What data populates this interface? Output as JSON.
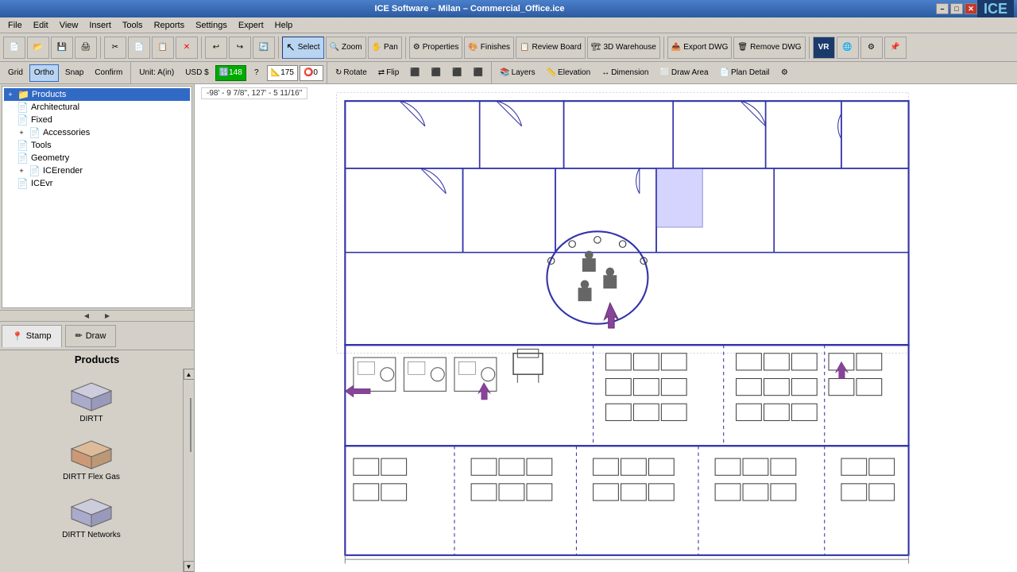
{
  "app": {
    "title": "ICE Software – Milan – Commercial_Office.ice",
    "logo": "ICE",
    "win_controls": [
      "–",
      "□",
      "✕"
    ]
  },
  "menu": {
    "items": [
      "File",
      "Edit",
      "View",
      "Insert",
      "Tools",
      "Reports",
      "Settings",
      "Expert",
      "Help"
    ]
  },
  "toolbar1": {
    "buttons": [
      {
        "label": "",
        "icon": "📄",
        "name": "new-btn"
      },
      {
        "label": "",
        "icon": "📂",
        "name": "open-btn"
      },
      {
        "label": "",
        "icon": "💾",
        "name": "save-btn"
      },
      {
        "label": "",
        "icon": "🖨",
        "name": "print-btn"
      },
      {
        "label": "",
        "icon": "✂",
        "name": "cut-btn"
      },
      {
        "label": "",
        "icon": "📋",
        "name": "paste-btn"
      },
      {
        "label": "",
        "icon": "🗑",
        "name": "delete-btn"
      },
      {
        "label": "",
        "icon": "↩",
        "name": "undo-btn"
      },
      {
        "label": "",
        "icon": "↪",
        "name": "redo-btn"
      },
      {
        "label": "",
        "icon": "🔄",
        "name": "refresh-btn"
      },
      {
        "label": "Select",
        "icon": "↖",
        "name": "select-btn",
        "active": true
      },
      {
        "label": "Zoom",
        "icon": "🔍",
        "name": "zoom-btn"
      },
      {
        "label": "Pan",
        "icon": "✋",
        "name": "pan-btn"
      },
      {
        "label": "Properties",
        "icon": "⚙",
        "name": "properties-btn"
      },
      {
        "label": "Finishes",
        "icon": "🎨",
        "name": "finishes-btn"
      },
      {
        "label": "Review Board",
        "icon": "📋",
        "name": "review-board-btn"
      },
      {
        "label": "3D Warehouse",
        "icon": "🏗",
        "name": "3d-warehouse-btn"
      },
      {
        "label": "Export DWG",
        "icon": "📤",
        "name": "export-dwg-btn"
      },
      {
        "label": "Remove DWG",
        "icon": "❌",
        "name": "remove-dwg-btn"
      }
    ]
  },
  "toolbar2": {
    "grid_label": "Grid",
    "ortho_label": "Ortho",
    "snap_label": "Snap",
    "confirm_label": "Confirm",
    "unit_label": "Unit: A(in)",
    "currency_label": "USD $",
    "count_value": "148",
    "question_label": "?",
    "value_175": "175",
    "value_0": "0",
    "rotate_label": "Rotate",
    "flip_label": "Flip",
    "layers_label": "Layers",
    "elevation_label": "Elevation",
    "dimension_label": "Dimension",
    "draw_area_label": "Draw Area",
    "plan_detail_label": "Plan Detail"
  },
  "left_panel": {
    "tree": {
      "items": [
        {
          "label": "Products",
          "level": 0,
          "expanded": true,
          "selected": true,
          "has_expand": true
        },
        {
          "label": "Architectural",
          "level": 1,
          "expanded": false,
          "has_expand": false
        },
        {
          "label": "Fixed",
          "level": 1,
          "expanded": false,
          "has_expand": false
        },
        {
          "label": "Accessories",
          "level": 1,
          "expanded": false,
          "has_expand": true
        },
        {
          "label": "Tools",
          "level": 1,
          "expanded": false,
          "has_expand": false
        },
        {
          "label": "Geometry",
          "level": 1,
          "expanded": false,
          "has_expand": false
        },
        {
          "label": "ICErender",
          "level": 1,
          "expanded": false,
          "has_expand": true
        },
        {
          "label": "ICEvr",
          "level": 1,
          "expanded": false,
          "has_expand": false
        }
      ]
    }
  },
  "bottom_tabs": [
    {
      "label": "Stamp",
      "icon": "📍",
      "active": true
    },
    {
      "label": "Draw",
      "icon": "✏",
      "active": false
    }
  ],
  "products_panel": {
    "header": "Products",
    "items": [
      {
        "name": "DIRTT",
        "icon_color": "#aaaacc"
      },
      {
        "name": "DIRTT Flex Gas",
        "icon_color": "#cc9977"
      },
      {
        "name": "DIRTT Networks",
        "icon_color": "#aaaacc"
      }
    ]
  },
  "canvas": {
    "coord_display": "-98' - 9 7/8\", 127' - 5 11/16\""
  }
}
